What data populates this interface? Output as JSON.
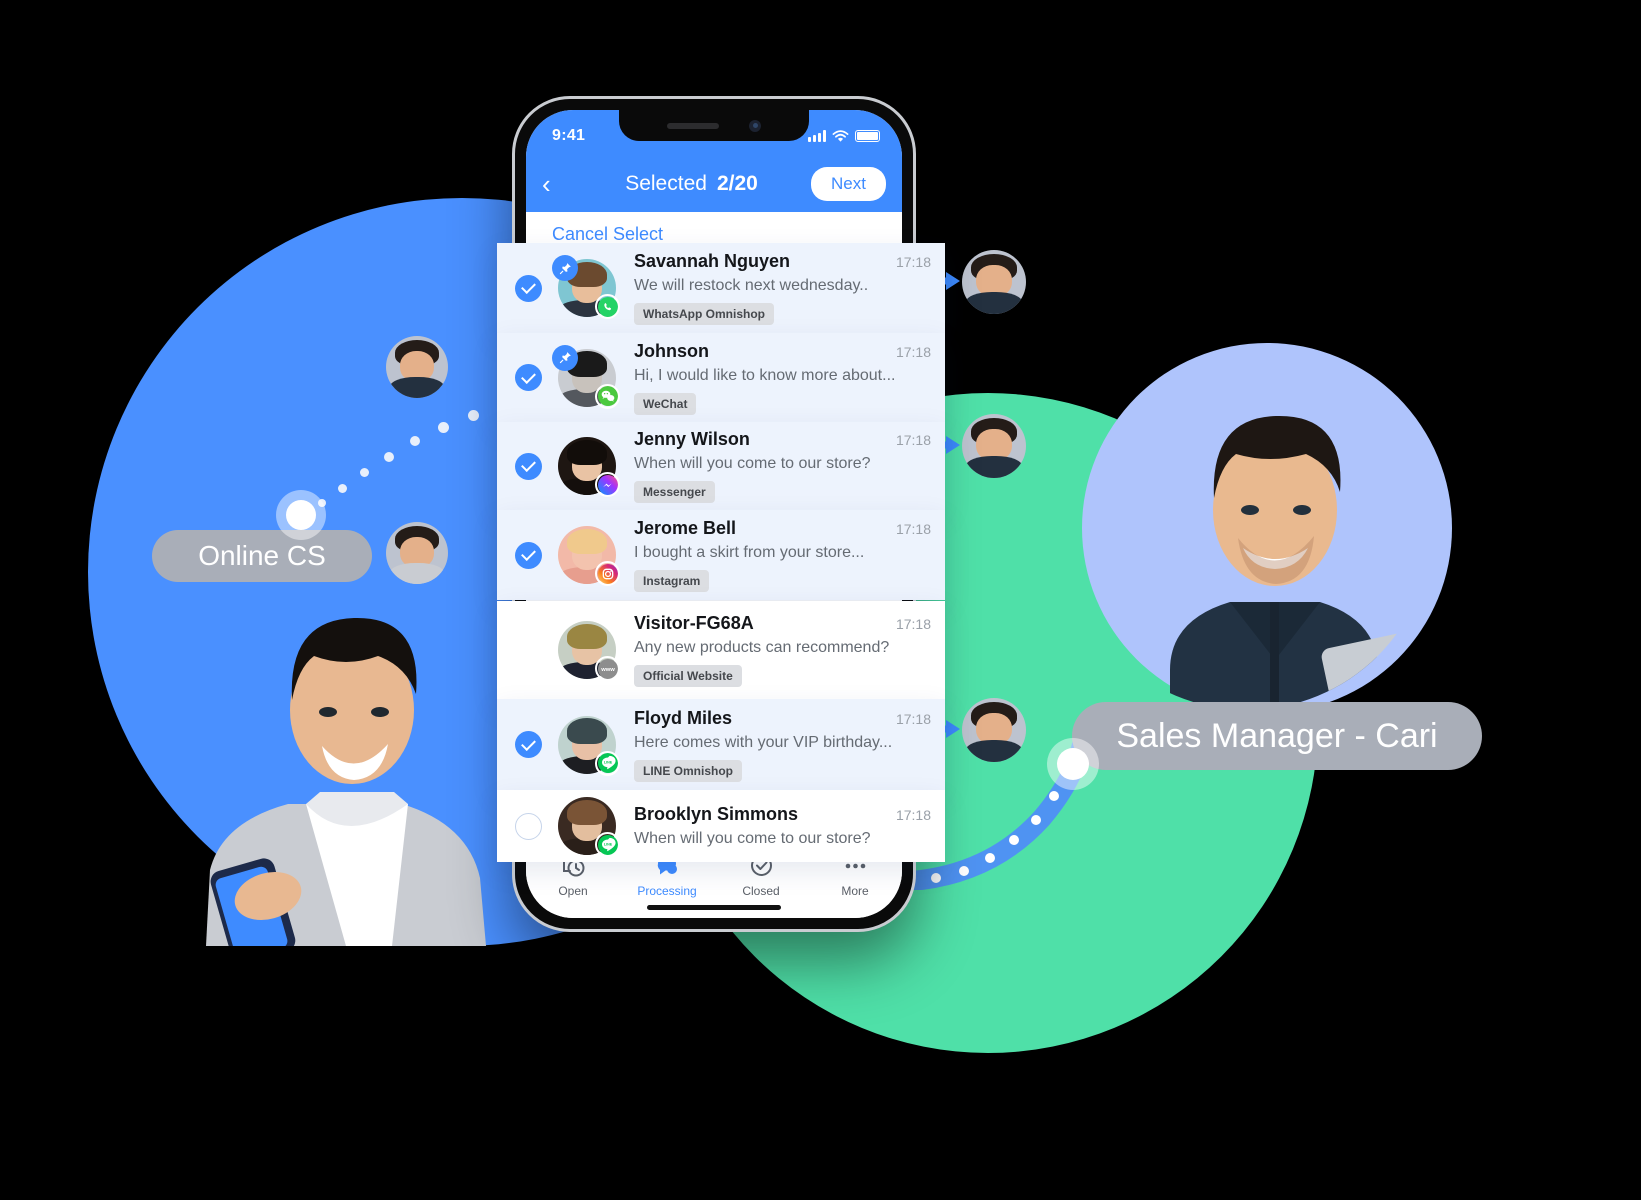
{
  "background": {
    "blue_circle_color": "#4A90FF",
    "green_circle_color": "#4FE0A8",
    "periwinkle_circle_color": "#AFC4FC",
    "accent_color": "#3E8BFF"
  },
  "roles": {
    "left": {
      "label": "Online CS"
    },
    "right": {
      "label": "Sales Manager - Cari"
    }
  },
  "phone": {
    "status_bar": {
      "time": "9:41"
    },
    "nav": {
      "back_icon": "chevron-left-icon",
      "title": "Selected",
      "count": "2/20",
      "next_label": "Next"
    },
    "cancel_select_label": "Cancel Select",
    "tabs": [
      {
        "label": "Open",
        "icon": "history-icon",
        "active": false
      },
      {
        "label": "Processing",
        "icon": "chat-bubble-icon",
        "active": true
      },
      {
        "label": "Closed",
        "icon": "check-circle-icon",
        "active": false
      },
      {
        "label": "More",
        "icon": "ellipsis-icon",
        "active": false
      }
    ]
  },
  "chats": [
    {
      "name": "Savannah Nguyen",
      "time": "17:18",
      "message": "We will restock next wednesday..",
      "tag": "WhatsApp Omnishop",
      "channel_icon": "whatsapp-icon",
      "channel_color": "#25D366",
      "selected": true,
      "pinned": true,
      "highlighted": true,
      "avatar": {
        "bg": "#7FC6D2",
        "hair": "#6B4A2F",
        "skin": "#E8BE9B",
        "body": "#2C3440"
      }
    },
    {
      "name": "Johnson",
      "time": "17:18",
      "message": "Hi, I would like to know more about...",
      "tag": "WeChat",
      "channel_icon": "wechat-icon",
      "channel_color": "#4CC93F",
      "selected": true,
      "pinned": true,
      "highlighted": true,
      "avatar": {
        "bg": "#C9CCD1",
        "hair": "#1A1A1A",
        "skin": "#C8C2BC",
        "body": "#54585E"
      }
    },
    {
      "name": "Jenny Wilson",
      "time": "17:18",
      "message": "When will you come to our store?",
      "tag": "Messenger",
      "channel_icon": "messenger-icon",
      "channel_color": "#A334FA",
      "selected": true,
      "pinned": false,
      "highlighted": true,
      "avatar": {
        "bg": "#1E1612",
        "hair": "#120D0A",
        "skin": "#E9C3A4",
        "body": "#140F0C"
      }
    },
    {
      "name": "Jerome Bell",
      "time": "17:18",
      "message": "I bought a skirt from your store...",
      "tag": "Instagram",
      "channel_icon": "instagram-icon",
      "channel_color": "#E1306C",
      "selected": true,
      "pinned": false,
      "highlighted": true,
      "avatar": {
        "bg": "#F2B9A8",
        "hair": "#F0C98C",
        "skin": "#F3C3AE",
        "body": "#E79E8E"
      }
    },
    {
      "name": "Visitor-FG68A",
      "time": "17:18",
      "message": "Any new products can recommend?",
      "tag": "Official Website",
      "channel_icon": "www-icon",
      "channel_color": "#8D8D8D",
      "selected": false,
      "pinned": false,
      "highlighted": false,
      "has_checkbox": false,
      "avatar": {
        "bg": "#C6CFC4",
        "hair": "#9A8642",
        "skin": "#E7C3A5",
        "body": "#1E2230"
      }
    },
    {
      "name": "Floyd Miles",
      "time": "17:18",
      "message": "Here comes with your VIP birthday...",
      "tag": "LINE Omnishop",
      "channel_icon": "line-icon",
      "channel_color": "#06C755",
      "selected": true,
      "pinned": false,
      "highlighted": true,
      "avatar": {
        "bg": "#BFD2CE",
        "hair": "#3A4A4E",
        "skin": "#E8C0A6",
        "body": "#1D1E22"
      }
    },
    {
      "name": "Brooklyn Simmons",
      "time": "17:18",
      "message": "When will you come to our store?",
      "tag": "",
      "channel_icon": "line-icon",
      "channel_color": "#06C755",
      "selected": false,
      "pinned": false,
      "highlighted": false,
      "has_checkbox": true,
      "avatar": {
        "bg": "#3A2A22",
        "hair": "#7A5436",
        "skin": "#E3BE9E",
        "body": "#2A1F19"
      }
    }
  ]
}
